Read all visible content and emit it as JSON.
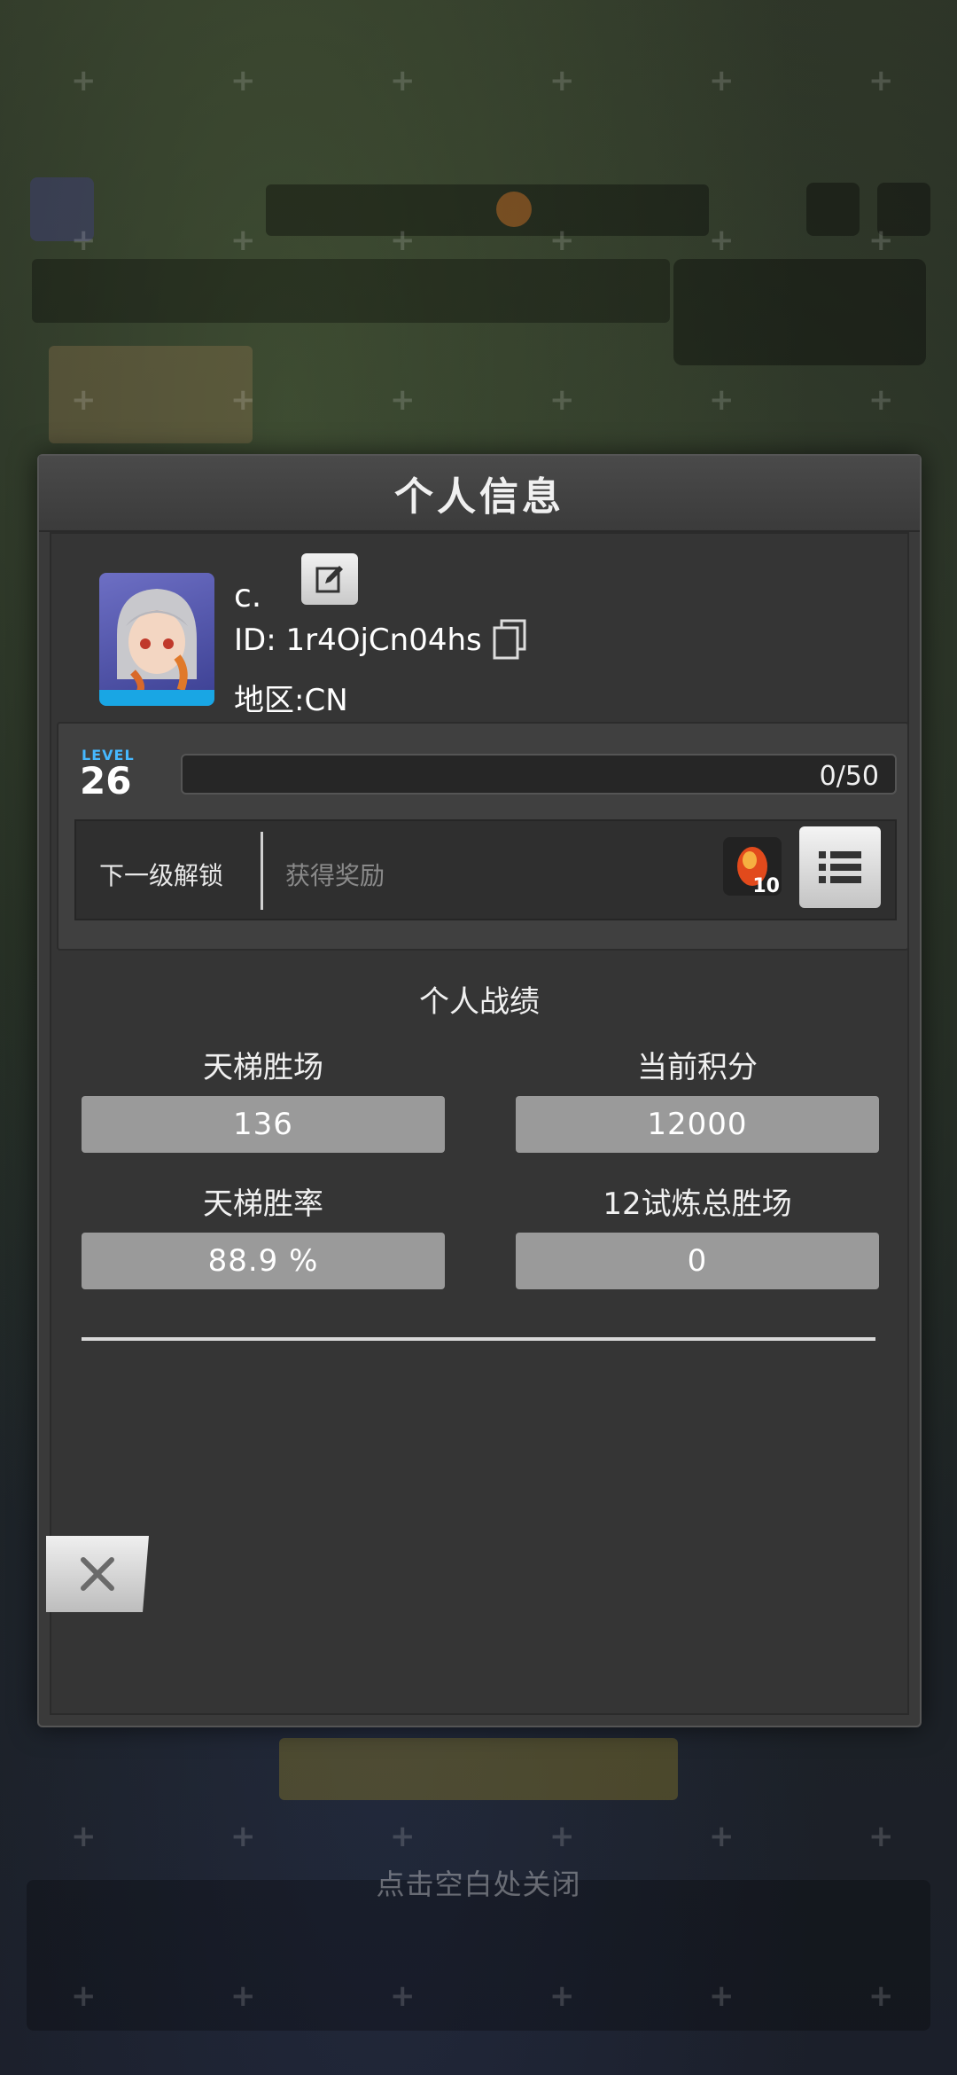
{
  "dialog": {
    "title": "个人信息"
  },
  "profile": {
    "name": "c.",
    "id_text": "ID: 1r4OjCn04hs",
    "region_text": "地区:CN"
  },
  "level": {
    "word": "LEVEL",
    "number": "26",
    "xp_text": "0/50",
    "xp_fraction": 0.0,
    "unlock_label": "下一级解锁",
    "reward_label": "获得奖励",
    "reward_count": "10"
  },
  "stats": {
    "title": "个人战绩",
    "ladder_wins_label": "天梯胜场",
    "ladder_wins_value": "136",
    "current_score_label": "当前积分",
    "current_score_value": "12000",
    "ladder_winrate_label": "天梯胜率",
    "ladder_winrate_value": "88.9 %",
    "trial_wins_label": "12试炼总胜场",
    "trial_wins_value": "0"
  },
  "hint": {
    "close_text": "点击空白处关闭"
  },
  "colors": {
    "level_accent": "#46b8ff",
    "avatar_bar": "#19a6e4",
    "stat_box": "#9a9a9a"
  }
}
